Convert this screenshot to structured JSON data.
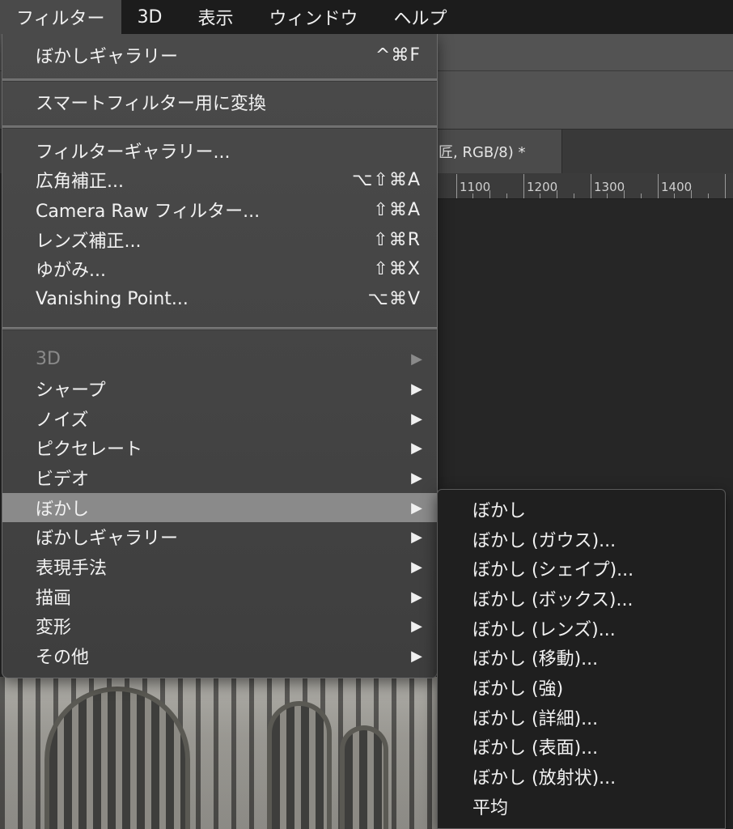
{
  "menubar": {
    "items": [
      {
        "label": "フィルター",
        "active": true
      },
      {
        "label": "3D",
        "active": false
      },
      {
        "label": "表示",
        "active": false
      },
      {
        "label": "ウィンドウ",
        "active": false
      },
      {
        "label": "ヘルプ",
        "active": false
      }
    ]
  },
  "document": {
    "tab_title": "匠, RGB/8) *",
    "ruler_labels": [
      "1100",
      "1200",
      "1300",
      "1400"
    ]
  },
  "filter_menu": {
    "items": [
      {
        "label": "ぼかしギャラリー",
        "shortcut": "^⌘F"
      },
      {
        "label": "スマートフィルター用に変換",
        "shortcut": ""
      },
      {
        "label": "フィルターギャラリー...",
        "shortcut": ""
      },
      {
        "label": "広角補正...",
        "shortcut": "⌥⇧⌘A"
      },
      {
        "label": "Camera Raw フィルター...",
        "shortcut": "⇧⌘A"
      },
      {
        "label": "レンズ補正...",
        "shortcut": "⇧⌘R"
      },
      {
        "label": "ゆがみ...",
        "shortcut": "⇧⌘X"
      },
      {
        "label": "Vanishing Point...",
        "shortcut": "⌥⌘V"
      }
    ],
    "submenus": [
      {
        "label": "3D",
        "arrow": "▶",
        "disabled": true
      },
      {
        "label": "シャープ",
        "arrow": "▶"
      },
      {
        "label": "ノイズ",
        "arrow": "▶"
      },
      {
        "label": "ピクセレート",
        "arrow": "▶"
      },
      {
        "label": "ビデオ",
        "arrow": "▶"
      },
      {
        "label": "ぼかし",
        "arrow": "▶",
        "highlighted": true
      },
      {
        "label": "ぼかしギャラリー",
        "arrow": "▶"
      },
      {
        "label": "表現手法",
        "arrow": "▶"
      },
      {
        "label": "描画",
        "arrow": "▶"
      },
      {
        "label": "変形",
        "arrow": "▶"
      },
      {
        "label": "その他",
        "arrow": "▶"
      }
    ]
  },
  "blur_submenu": {
    "items": [
      "ぼかし",
      "ぼかし (ガウス)...",
      "ぼかし (シェイプ)...",
      "ぼかし (ボックス)...",
      "ぼかし (レンズ)...",
      "ぼかし (移動)...",
      "ぼかし (強)",
      "ぼかし (詳細)...",
      "ぼかし (表面)...",
      "ぼかし (放射状)...",
      "平均"
    ]
  },
  "colors": {
    "menubar_bg": "#1c1c1c",
    "menu_bg": "#444444",
    "highlight": "#8a8a8a",
    "submenu_bg": "#1f1f1f",
    "text": "#f2f2f2",
    "disabled_text": "#8a8a8a"
  }
}
